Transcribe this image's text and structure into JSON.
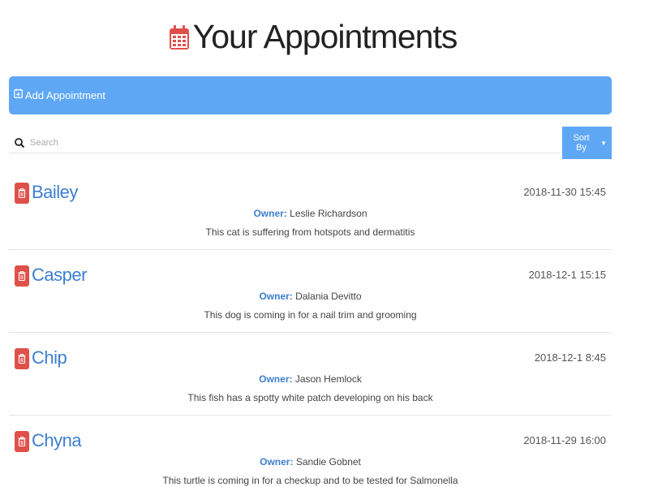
{
  "header": {
    "title": "Your Appointments",
    "icon": "calendar-icon",
    "icon_color": "#e0504a"
  },
  "add_bar": {
    "label": "Add Appointment",
    "icon": "calendar-plus-icon",
    "color": "#5ea7f5"
  },
  "search": {
    "placeholder": "Search",
    "value": "",
    "icon": "search-icon"
  },
  "sort": {
    "label": "Sort By",
    "icon": "caret-down-icon"
  },
  "colors": {
    "accent": "#5ea7f5",
    "pet_name": "#3d7fd0",
    "delete": "#e0504a"
  },
  "appointments": [
    {
      "pet_name": "Bailey",
      "date": "2018-11-30 15:45",
      "owner_label": "Owner:",
      "owner": "Leslie Richardson",
      "notes": "This cat is suffering from hotspots and dermatitis"
    },
    {
      "pet_name": "Casper",
      "date": "2018-12-1 15:15",
      "owner_label": "Owner:",
      "owner": "Dalania Devitto",
      "notes": "This dog is coming in for a nail trim and grooming"
    },
    {
      "pet_name": "Chip",
      "date": "2018-12-1 8:45",
      "owner_label": "Owner:",
      "owner": "Jason Hemlock",
      "notes": "This fish has a spotty white patch developing on his back"
    },
    {
      "pet_name": "Chyna",
      "date": "2018-11-29 16:00",
      "owner_label": "Owner:",
      "owner": "Sandie Gobnet",
      "notes": "This turtle is coming in for a checkup and to be tested for Salmonella"
    }
  ]
}
